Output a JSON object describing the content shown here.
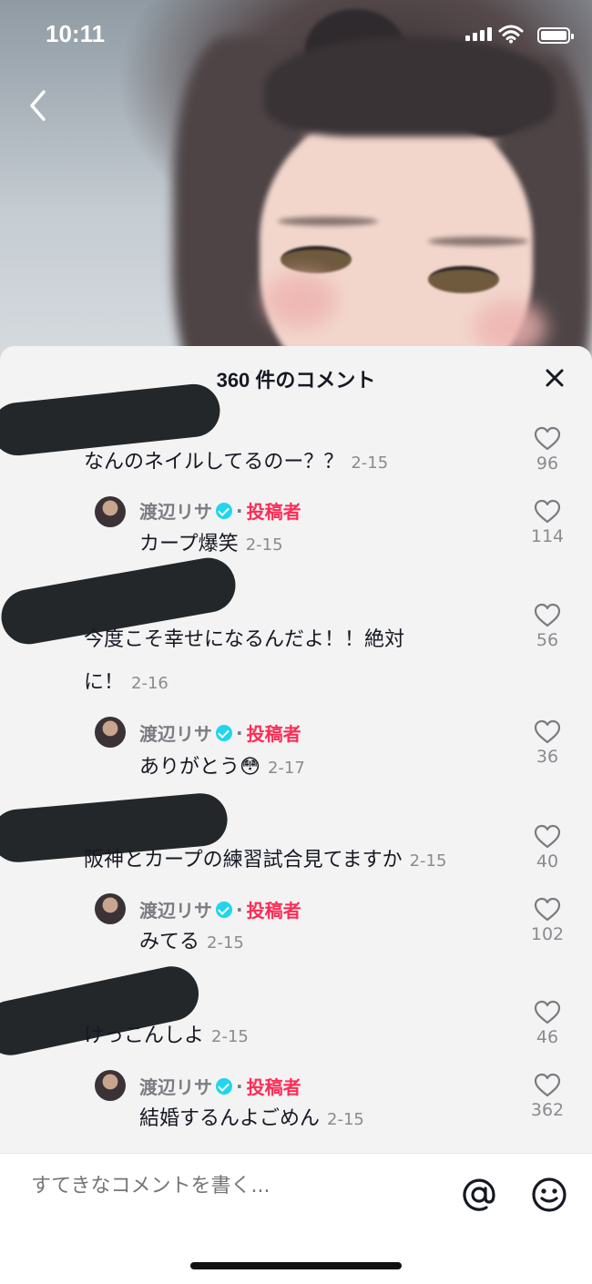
{
  "status_bar": {
    "time": "10:11"
  },
  "sheet": {
    "title": "360 件のコメント"
  },
  "author_badge": "投稿者",
  "author_name": "渡辺リサ",
  "comments": [
    {
      "text": "なんのネイルしてるのー？？",
      "date": "2-15",
      "likes": "96",
      "reply": {
        "text": "カープ爆笑",
        "date": "2-15",
        "likes": "114"
      }
    },
    {
      "text_line1": "今度こそ幸せになるんだよ！！絶対",
      "text_line2": "に！",
      "date": "2-16",
      "likes": "56",
      "reply": {
        "text": "ありがとう😳",
        "date": "2-17",
        "likes": "36"
      }
    },
    {
      "text": "阪神とカープの練習試合見てますか",
      "date": "2-15",
      "likes": "40",
      "reply": {
        "text": "みてる",
        "date": "2-15",
        "likes": "102"
      }
    },
    {
      "text": "けっこんしよ",
      "date": "2-15",
      "likes": "46",
      "reply": {
        "text": "結婚するんよごめん",
        "date": "2-15",
        "likes": "362"
      }
    }
  ],
  "input": {
    "placeholder": "すてきなコメントを書く..."
  },
  "icons": {
    "mention": "at-icon",
    "emoji": "emoji-icon",
    "like": "heart-icon",
    "close": "close-icon",
    "back": "chevron-left-icon"
  },
  "colors": {
    "author_accent": "#fe2c55",
    "verified": "#20d5ec",
    "sheet_bg": "#f3f3f3",
    "redaction": "#23272a"
  }
}
